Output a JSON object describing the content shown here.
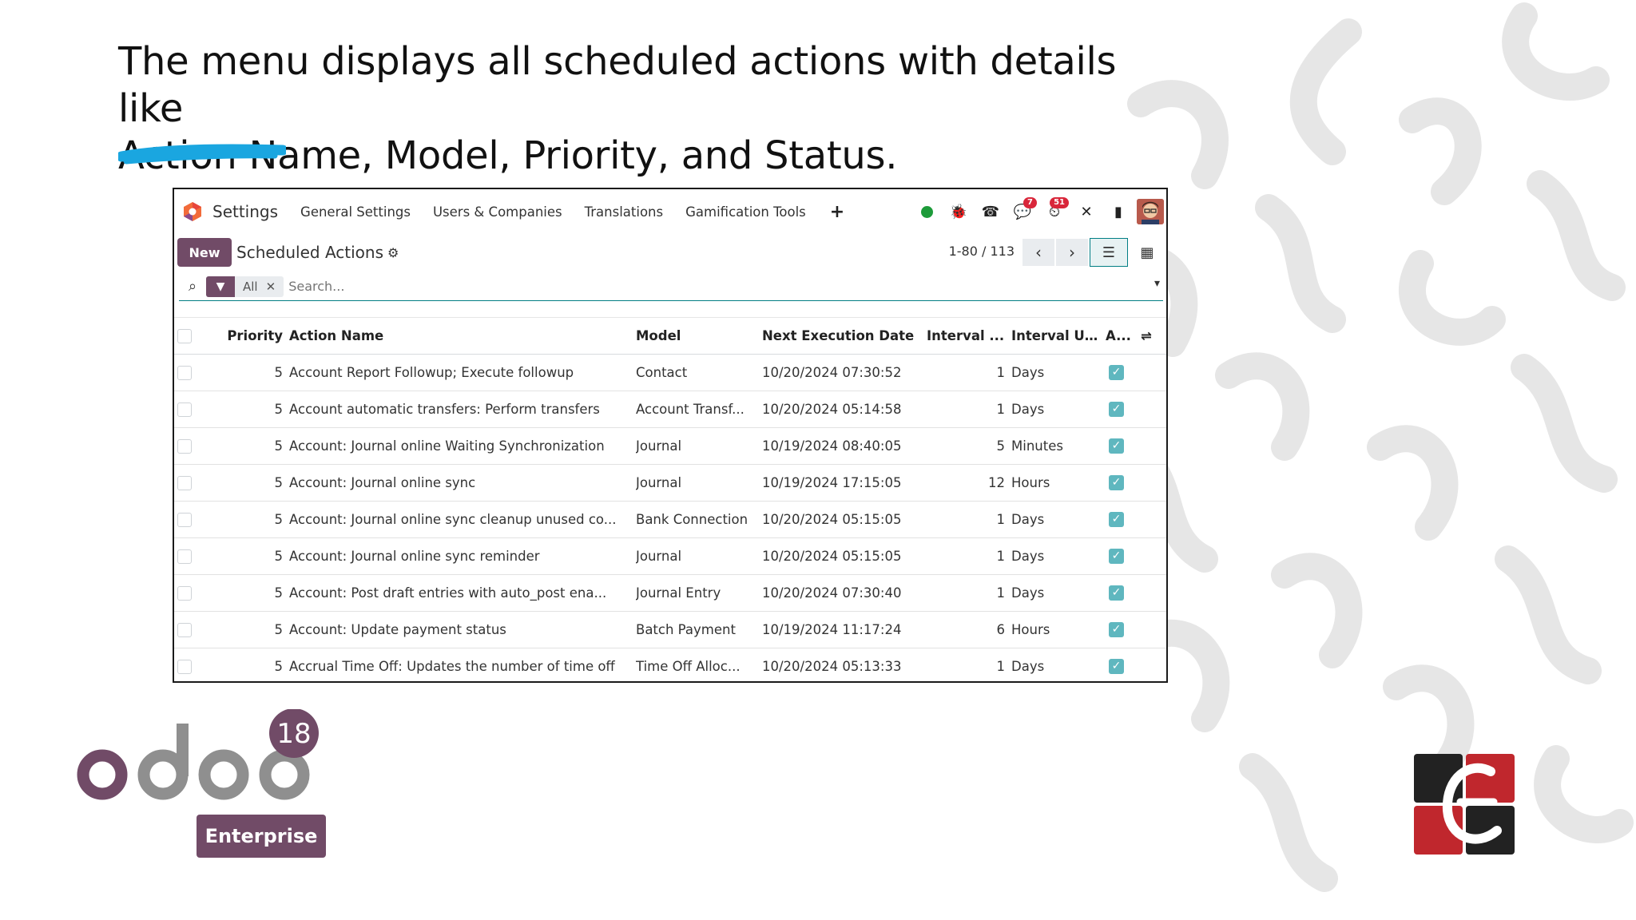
{
  "slide": {
    "headline_line1": "The menu displays all scheduled actions with details like",
    "headline_line2": "Action Name, Model, Priority, and Status.",
    "logo_version": "18",
    "enterprise_label": "Enterprise",
    "colors": {
      "accent_blue": "#1aa6e0",
      "odoo_purple": "#714b67",
      "brand_red": "#c0272d"
    }
  },
  "navbar": {
    "app_name": "Settings",
    "menu": [
      "General Settings",
      "Users & Companies",
      "Translations",
      "Gamification Tools"
    ],
    "plus": "+",
    "badges": {
      "messages": "7",
      "activities": "51"
    }
  },
  "control": {
    "new_label": "New",
    "title": "Scheduled Actions",
    "pager": "1-80 / 113"
  },
  "search": {
    "facet_label": "All",
    "placeholder": "Search..."
  },
  "table": {
    "headers": [
      "Priority",
      "Action Name",
      "Model",
      "Next Execution Date",
      "Interval ...",
      "Interval U...",
      "A..."
    ],
    "rows": [
      {
        "priority": "5",
        "name": "Account Report Followup; Execute followup",
        "model": "Contact",
        "next": "10/20/2024 07:30:52",
        "interval": "1",
        "unit": "Days"
      },
      {
        "priority": "5",
        "name": "Account automatic transfers: Perform transfers",
        "model": "Account Transf...",
        "next": "10/20/2024 05:14:58",
        "interval": "1",
        "unit": "Days"
      },
      {
        "priority": "5",
        "name": "Account: Journal online Waiting Synchronization",
        "model": "Journal",
        "next": "10/19/2024 08:40:05",
        "interval": "5",
        "unit": "Minutes"
      },
      {
        "priority": "5",
        "name": "Account: Journal online sync",
        "model": "Journal",
        "next": "10/19/2024 17:15:05",
        "interval": "12",
        "unit": "Hours"
      },
      {
        "priority": "5",
        "name": "Account: Journal online sync cleanup unused co...",
        "model": "Bank Connection",
        "next": "10/20/2024 05:15:05",
        "interval": "1",
        "unit": "Days"
      },
      {
        "priority": "5",
        "name": "Account: Journal online sync reminder",
        "model": "Journal",
        "next": "10/20/2024 05:15:05",
        "interval": "1",
        "unit": "Days"
      },
      {
        "priority": "5",
        "name": "Account: Post draft entries with auto_post ena...",
        "model": "Journal Entry",
        "next": "10/20/2024 07:30:40",
        "interval": "1",
        "unit": "Days"
      },
      {
        "priority": "5",
        "name": "Account: Update payment status",
        "model": "Batch Payment",
        "next": "10/19/2024 11:17:24",
        "interval": "6",
        "unit": "Hours"
      },
      {
        "priority": "5",
        "name": "Accrual Time Off: Updates the number of time off",
        "model": "Time Off Alloc...",
        "next": "10/20/2024 05:13:33",
        "interval": "1",
        "unit": "Days"
      }
    ]
  }
}
